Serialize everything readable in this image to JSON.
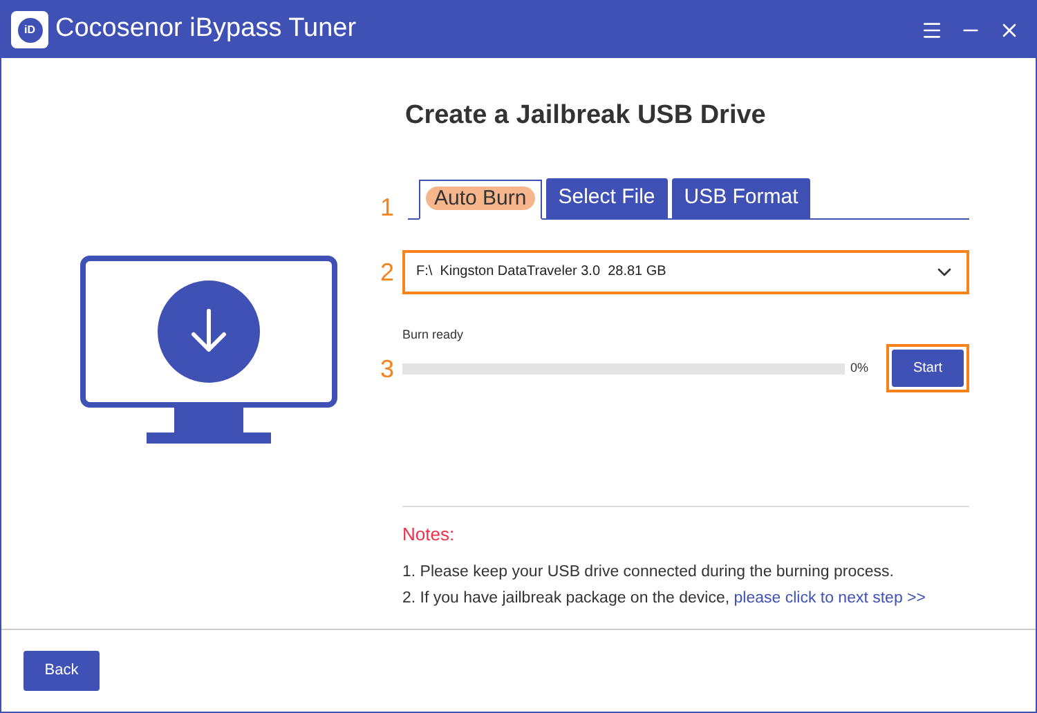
{
  "window": {
    "title": "Cocosenor iBypass Tuner",
    "logo_text": "iD"
  },
  "heading": "Create a Jailbreak USB Drive",
  "steps": [
    {
      "number": "1"
    },
    {
      "number": "2"
    },
    {
      "number": "3"
    }
  ],
  "tabs": [
    {
      "label": "Auto Burn",
      "selected": true
    },
    {
      "label": "Select File",
      "selected": false
    },
    {
      "label": "USB Format",
      "selected": false
    }
  ],
  "drive_select": {
    "value": "F:\\  Kingston DataTraveler 3.0  28.81 GB"
  },
  "progress": {
    "label": "Burn ready",
    "level": 0,
    "reading": "0%"
  },
  "start_button": "Start",
  "notes": {
    "title": "Notes:",
    "items": [
      {
        "text": "1. Please keep your USB drive connected during the burning process."
      },
      {
        "text": "2. If you have jailbreak package on the device, ",
        "link": "please click to next step >>"
      }
    ]
  },
  "back_button": "Back"
}
